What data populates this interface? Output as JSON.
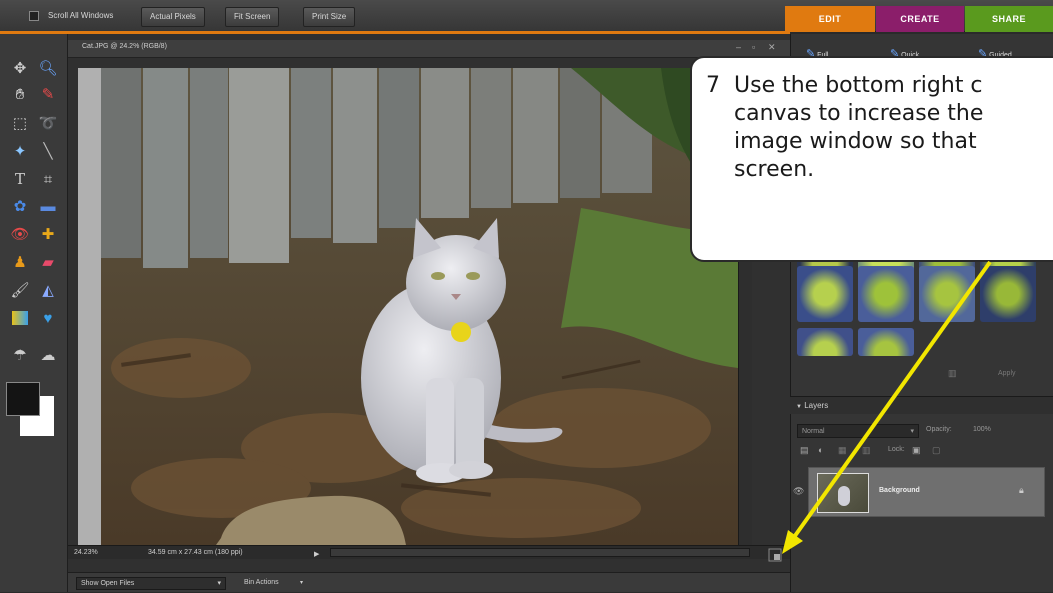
{
  "toolbar": {
    "scroll_all_label": "Scroll All Windows",
    "actual_pixels_label": "Actual Pixels",
    "fit_screen_label": "Fit Screen",
    "print_size_label": "Print Size"
  },
  "mode_tabs": [
    {
      "label": "EDIT",
      "color": "#e07a10"
    },
    {
      "label": "CREATE",
      "color": "#8b1e6a"
    },
    {
      "label": "SHARE",
      "color": "#5a9a1e"
    }
  ],
  "document": {
    "title": "Cat.JPG @ 24.2% (RGB/8)",
    "zoom": "24.23%",
    "dimensions": "34.59 cm x 27.43 cm (180 ppi)"
  },
  "edit_modes": {
    "full": "Full",
    "quick": "Quick",
    "guided": "Guided"
  },
  "layers_panel": {
    "header": "Layers",
    "blend_mode": "Normal",
    "opacity_label": "Opacity:",
    "opacity_value": "100%",
    "lock_label": "Lock:",
    "layer_name": "Background"
  },
  "effects_panel": {
    "apply_label": "Apply"
  },
  "project_bin": {
    "show_label": "Show Open Files",
    "bin_actions_label": "Bin Actions"
  },
  "callout": {
    "step": "7",
    "line1": "Use the bottom right c",
    "line2": "canvas to increase the",
    "line3": "image window so that",
    "line4": "screen."
  },
  "colors": {
    "arrow": "#f2e600",
    "foreground_swatch": "#141414",
    "background_swatch": "#ffffff"
  }
}
